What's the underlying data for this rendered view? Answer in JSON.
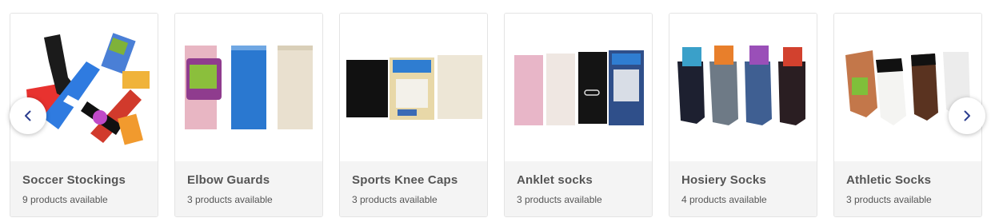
{
  "carousel": {
    "prev_icon": "chevron-left-icon",
    "next_icon": "chevron-right-icon",
    "accent_color": "#2c3e8f",
    "categories": [
      {
        "title": "Soccer Stockings",
        "count": "9 products available"
      },
      {
        "title": "Elbow Guards",
        "count": "3 products available"
      },
      {
        "title": "Sports Knee Caps",
        "count": "3 products available"
      },
      {
        "title": "Anklet socks",
        "count": "3 products available"
      },
      {
        "title": "Hosiery Socks",
        "count": "4 products available"
      },
      {
        "title": "Athletic Socks",
        "count": "3 products available"
      }
    ]
  }
}
